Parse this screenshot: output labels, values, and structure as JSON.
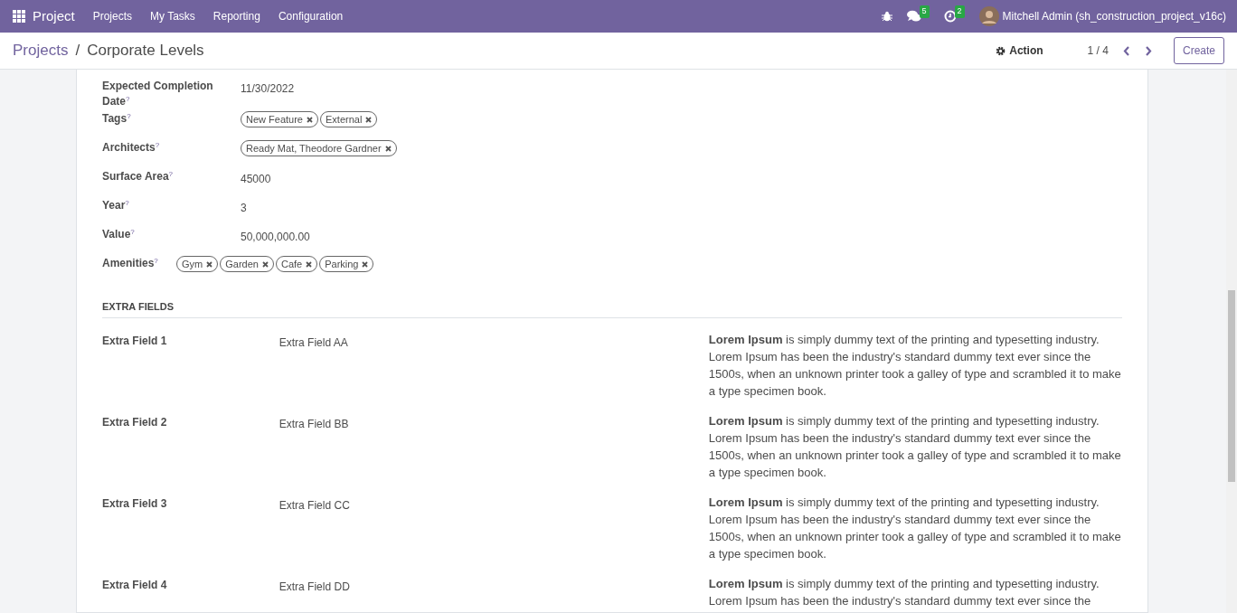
{
  "navbar": {
    "app": "Project",
    "menus": [
      "Projects",
      "My Tasks",
      "Reporting",
      "Configuration"
    ],
    "messages_count": "5",
    "activities_count": "2",
    "user": "Mitchell Admin (sh_construction_project_v16c)"
  },
  "breadcrumb": {
    "parent": "Projects",
    "separator": "/",
    "current": "Corporate Levels"
  },
  "control_panel": {
    "action": "Action",
    "pager": "1 / 4",
    "create": "Create"
  },
  "fields": [
    {
      "label": "Expected Completion Date$^{?}$",
      "kind": "text",
      "value": "11/30/2022"
    },
    {
      "label": "Tags$^{?}$",
      "kind": "tags",
      "tags": [
        "New Feature",
        "External"
      ]
    },
    {
      "label": "Architects$^{?}$",
      "kind": "tags",
      "tags": [
        "Ready Mat, Theodore Gardner"
      ]
    },
    {
      "label": "Surface Area$^{?}$",
      "kind": "text",
      "value": "45000"
    },
    {
      "label": "Year$^{?}$",
      "kind": "text",
      "value": "3"
    },
    {
      "label": "Value$^{?}$",
      "kind": "text",
      "value": "50,000,000.00"
    },
    {
      "label": "Amenities$^{?}$",
      "kind": "tags",
      "tags": [
        "Gym",
        "Garden",
        "Cafe",
        "Parking"
      ]
    }
  ],
  "section_title": "EXTRA FIELDS",
  "extra_fields": [
    {
      "label": "Extra Field 1",
      "value": "Extra Field AA",
      "description": "**Lorem Ipsum** is simply dummy text of the printing and typesetting industry. Lorem Ipsum has been the industry's standard dummy text ever since the 1500s, when an unknown printer took a galley of type and scrambled it to make a type specimen book."
    },
    {
      "label": "Extra Field 2",
      "value": "Extra Field BB",
      "description": "**Lorem Ipsum** is simply dummy text of the printing and typesetting industry. Lorem Ipsum has been the industry's standard dummy text ever since the 1500s, when an unknown printer took a galley of type and scrambled it to make a type specimen book."
    },
    {
      "label": "Extra Field 3",
      "value": "Extra Field CC",
      "description": "**Lorem Ipsum** is simply dummy text of the printing and typesetting industry. Lorem Ipsum has been the industry's standard dummy text ever since the 1500s, when an unknown printer took a galley of type and scrambled it to make a type specimen book."
    },
    {
      "label": "Extra Field 4",
      "value": "Extra Field DD",
      "description": "**Lorem Ipsum** is simply dummy text of the printing and typesetting industry. Lorem Ipsum has been the industry's standard dummy text ever since the"
    }
  ]
}
